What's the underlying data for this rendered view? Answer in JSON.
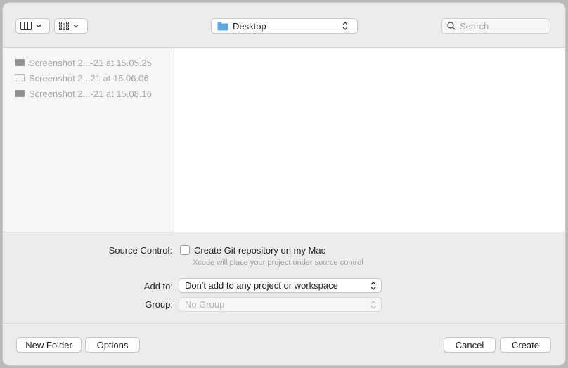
{
  "toolbar": {
    "view_mode_icon": "columns-icon",
    "group_mode_icon": "grid-icon",
    "location": "Desktop",
    "search_placeholder": "Search"
  },
  "files": [
    {
      "name": "Screenshot 2...-21 at 15.05.25",
      "icon": "screenshot-dark"
    },
    {
      "name": "Screenshot 2...21 at 15.06.06",
      "icon": "screenshot-light"
    },
    {
      "name": "Screenshot 2...-21 at 15.08.16",
      "icon": "screenshot-dark"
    }
  ],
  "options": {
    "source_control_label": "Source Control:",
    "git_checkbox_label": "Create Git repository on my Mac",
    "git_checked": false,
    "git_hint": "Xcode will place your project under source control",
    "add_to_label": "Add to:",
    "add_to_value": "Don't add to any project or workspace",
    "group_label": "Group:",
    "group_value": "No Group"
  },
  "buttons": {
    "new_folder": "New Folder",
    "options": "Options",
    "cancel": "Cancel",
    "create": "Create"
  },
  "colors": {
    "folder_blue": "#5aa9e6",
    "dialog_bg": "#ececec"
  }
}
